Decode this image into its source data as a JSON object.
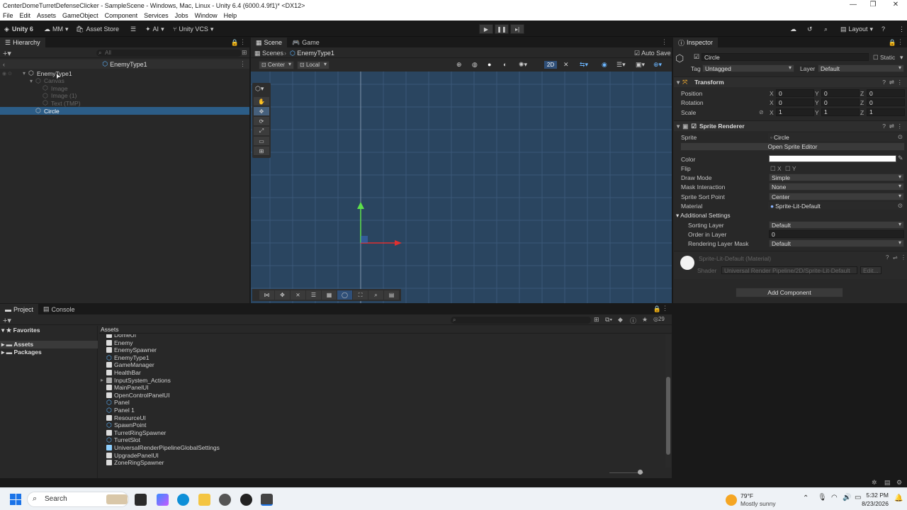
{
  "window": {
    "title": "CenterDomeTurretDefenseClicker - SampleScene - Windows, Mac, Linux - Unity 6.4 (6000.4.9f1)* <DX12>"
  },
  "menu": [
    "File",
    "Edit",
    "Assets",
    "GameObject",
    "Component",
    "Services",
    "Jobs",
    "Window",
    "Help"
  ],
  "toolbar": {
    "unity": "Unity 6",
    "account": "MM",
    "asset_store": "Asset Store",
    "ai": "AI",
    "vcs": "Unity VCS",
    "layout": "Layout"
  },
  "hierarchy": {
    "tab": "Hierarchy",
    "search_placeholder": "All",
    "context": "EnemyType1",
    "items": [
      {
        "label": "EnemyType1",
        "indent": 0,
        "selected": false,
        "dim": false
      },
      {
        "label": "Canvas",
        "indent": 1,
        "selected": false,
        "dim": true
      },
      {
        "label": "Image",
        "indent": 2,
        "selected": false,
        "dim": true
      },
      {
        "label": "Image (1)",
        "indent": 2,
        "selected": false,
        "dim": true
      },
      {
        "label": "Text (TMP)",
        "indent": 2,
        "selected": false,
        "dim": true
      },
      {
        "label": "Circle",
        "indent": 1,
        "selected": true,
        "dim": false
      }
    ]
  },
  "scene": {
    "tabs": [
      "Scene",
      "Game"
    ],
    "breadcrumb_root": "Scenes",
    "breadcrumb_prefab": "EnemyType1",
    "auto_save": "Auto Save",
    "pivot": "Center",
    "space": "Local",
    "mode_2d": "2D"
  },
  "inspector": {
    "tab": "Inspector",
    "object_name": "Circle",
    "static": "Static",
    "tag_label": "Tag",
    "tag": "Untagged",
    "layer_label": "Layer",
    "layer": "Default",
    "transform": {
      "title": "Transform",
      "rows": [
        {
          "label": "Position",
          "x": "0",
          "y": "0",
          "z": "0"
        },
        {
          "label": "Rotation",
          "x": "0",
          "y": "0",
          "z": "0"
        },
        {
          "label": "Scale",
          "x": "1",
          "y": "1",
          "z": "1"
        }
      ]
    },
    "sprite_renderer": {
      "title": "Sprite Renderer",
      "sprite_label": "Sprite",
      "sprite": "Circle",
      "open_editor": "Open Sprite Editor",
      "color_label": "Color",
      "flip_label": "Flip",
      "flip_x": "X",
      "flip_y": "Y",
      "draw_mode_label": "Draw Mode",
      "draw_mode": "Simple",
      "mask_label": "Mask Interaction",
      "mask": "None",
      "sort_point_label": "Sprite Sort Point",
      "sort_point": "Center",
      "material_label": "Material",
      "material": "Sprite-Lit-Default",
      "additional": "Additional Settings",
      "sorting_layer_label": "Sorting Layer",
      "sorting_layer": "Default",
      "order_label": "Order in Layer",
      "order": "0",
      "rlm_label": "Rendering Layer Mask",
      "rlm": "Default"
    },
    "material_block": {
      "name": "Sprite-Lit-Default (Material)",
      "shader_label": "Shader",
      "shader": "Universal Render Pipeline/2D/Sprite-Lit-Default",
      "edit": "Edit..."
    },
    "add_component": "Add Component"
  },
  "project": {
    "tabs": [
      "Project",
      "Console"
    ],
    "favorites": "Favorites",
    "assets": "Assets",
    "packages": "Packages",
    "breadcrumb": "Assets",
    "count": "29",
    "items": [
      {
        "name": "DomeUI",
        "kind": "script"
      },
      {
        "name": "Enemy",
        "kind": "script"
      },
      {
        "name": "EnemySpawner",
        "kind": "script"
      },
      {
        "name": "EnemyType1",
        "kind": "prefab"
      },
      {
        "name": "GameManager",
        "kind": "script"
      },
      {
        "name": "HealthBar",
        "kind": "script"
      },
      {
        "name": "InputSystem_Actions",
        "kind": "input"
      },
      {
        "name": "MainPanelUI",
        "kind": "script"
      },
      {
        "name": "OpenControlPanelUI",
        "kind": "script"
      },
      {
        "name": "Panel",
        "kind": "prefab"
      },
      {
        "name": "Panel 1",
        "kind": "prefab"
      },
      {
        "name": "ResourceUI",
        "kind": "script"
      },
      {
        "name": "SpawnPoint",
        "kind": "prefab"
      },
      {
        "name": "TurretRingSpawner",
        "kind": "script"
      },
      {
        "name": "TurretSlot",
        "kind": "prefab"
      },
      {
        "name": "UniversalRenderPipelineGlobalSettings",
        "kind": "settings"
      },
      {
        "name": "UpgradePanelUI",
        "kind": "script"
      },
      {
        "name": "ZoneRingSpawner",
        "kind": "script"
      }
    ]
  },
  "taskbar": {
    "search": "Search",
    "weather_temp": "79°F",
    "weather_desc": "Mostly sunny",
    "time": "5:32 PM",
    "date": "8/23/2026"
  },
  "colors": {
    "accent": "#2c5d87",
    "scene_bg": "#2a4560",
    "grid": "#3a5878",
    "y_axis": "#5ee04a",
    "x_axis": "#e03030"
  }
}
